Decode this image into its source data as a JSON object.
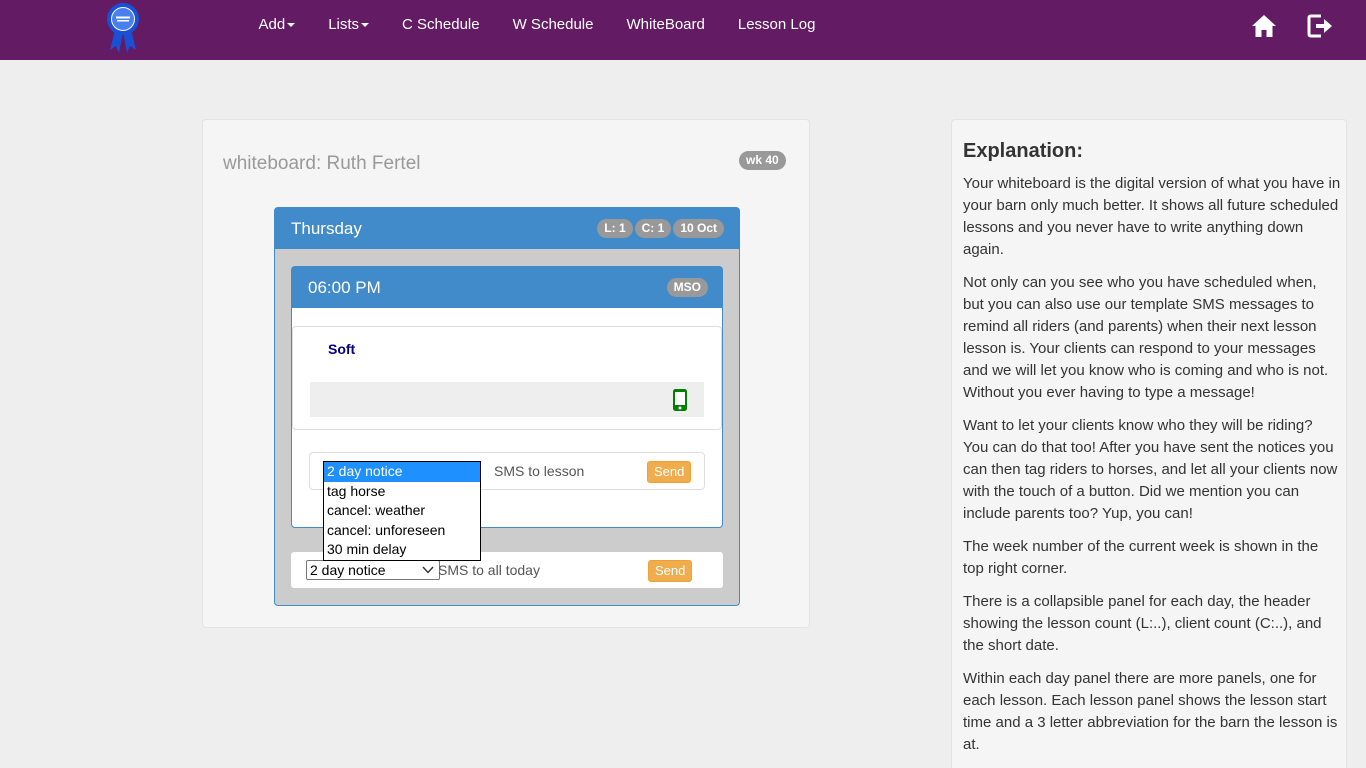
{
  "nav": {
    "items": [
      {
        "label": "Add",
        "dropdown": true
      },
      {
        "label": "Lists",
        "dropdown": true
      },
      {
        "label": "C Schedule",
        "dropdown": false
      },
      {
        "label": "W Schedule",
        "dropdown": false
      },
      {
        "label": "WhiteBoard",
        "dropdown": false
      },
      {
        "label": "Lesson Log",
        "dropdown": false
      }
    ],
    "icons": [
      "ribbon-logo-icon",
      "home-icon",
      "logout-icon"
    ]
  },
  "whiteboard": {
    "title": "whiteboard: Ruth Fertel",
    "week_badge": "wk 40",
    "day": {
      "name": "Thursday",
      "badges": [
        "L: 1",
        "C: 1",
        "10 Oct"
      ],
      "lesson": {
        "time": "06:00 PM",
        "barn": "MSO",
        "rider": "Soft",
        "sms_label": "SMS to lesson",
        "send_label": "Send",
        "dropdown_options": [
          "2 day notice",
          "tag horse",
          "cancel: weather",
          "cancel: unforeseen",
          "30 min delay"
        ],
        "dropdown_selected": "2 day notice"
      },
      "all_today": {
        "selected": "2 day notice",
        "sms_label": "SMS to all today",
        "send_label": "Send"
      }
    }
  },
  "explanation": {
    "title": "Explanation:",
    "paragraphs": [
      "Your whiteboard is the digital version of what you have in your barn only much better. It shows all future scheduled lessons and you never have to write anything down again.",
      "Not only can you see who you have scheduled when, but you can also use our template SMS messages to remind all riders (and parents) when their next lesson lesson is. Your clients can respond to your messages and we will let you know who is coming and who is not. Without you ever having to type a message!",
      "Want to let your clients know who they will be riding? You can do that too! After you have sent the notices you can then tag riders to horses, and let all your clients now with the touch of a button. Did we mention you can include parents too? Yup, you can!",
      "The week number of the current week is shown in the top right corner.",
      "There is a collapsible panel for each day, the header showing the lesson count (L:..), client count (C:..), and the short date.",
      "Within each day panel there are more panels, one for each lesson. Each lesson panel shows the lesson start time and a 3 letter abbreviation for the barn the lesson is at."
    ]
  },
  "colors": {
    "navbar": "#631b63",
    "primary": "#428bca",
    "warning": "#f0ad4e",
    "badge": "#999999",
    "phone": "#008000"
  }
}
